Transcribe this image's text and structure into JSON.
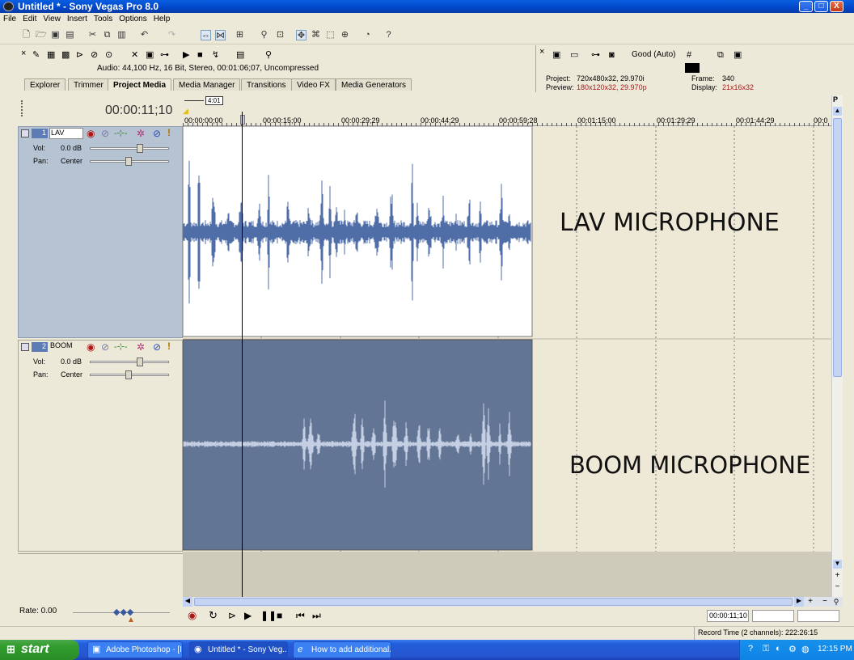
{
  "window": {
    "title": "Untitled * - Sony Vegas Pro 8.0",
    "controls": {
      "minimize": "_",
      "maximize": "□",
      "close": "X"
    }
  },
  "menu": [
    "File",
    "Edit",
    "View",
    "Insert",
    "Tools",
    "Options",
    "Help"
  ],
  "explorer": {
    "audio_info": "Audio: 44,100 Hz, 16 Bit, Stereo, 00:01:06;07, Uncompressed",
    "tabs": [
      "Explorer",
      "Trimmer",
      "Project Media",
      "Media Manager",
      "Transitions",
      "Video FX",
      "Media Generators"
    ],
    "active_tab": "Project Media"
  },
  "preview": {
    "quality": "Good (Auto)",
    "project_label": "Project:",
    "project_value": "720x480x32, 29.970i",
    "preview_label": "Preview:",
    "preview_value": "180x120x32, 29.970p",
    "frame_label": "Frame:",
    "frame_value": "340",
    "display_label": "Display:",
    "display_value": "21x16x32"
  },
  "timeline": {
    "timecode": "00:00:11;10",
    "loop_marker": "4:01",
    "ruler_labels": [
      "00:00:00;00",
      "00:00:15;00",
      "00:00:29;29",
      "00:00:44;29",
      "00:00:59;28",
      "00:01:15;00",
      "00:01:29;29",
      "00:01:44;29",
      "00:0"
    ]
  },
  "tracks": [
    {
      "number": "1",
      "name": "LAV",
      "vol_label": "Vol:",
      "vol_value": "0.0 dB",
      "pan_label": "Pan:",
      "pan_value": "Center"
    },
    {
      "number": "2",
      "name": "BOOM",
      "vol_label": "Vol:",
      "vol_value": "0.0 dB",
      "pan_label": "Pan:",
      "pan_value": "Center"
    }
  ],
  "overlays": {
    "lav": "LAV MICROPHONE",
    "boom": "BOOM MICROPHONE"
  },
  "rate": {
    "label": "Rate: 0.00"
  },
  "transport": {
    "timecode": "00:00:11;10"
  },
  "status": {
    "record_time": "Record Time (2 channels): 222:26:15"
  },
  "taskbar": {
    "start": "start",
    "tasks": [
      {
        "label": "Adobe Photoshop - [I...",
        "active": false
      },
      {
        "label": "Untitled * - Sony Veg...",
        "active": true
      },
      {
        "label": "How to add additional...",
        "active": false
      }
    ],
    "clock": "12:15 PM"
  },
  "colors": {
    "lav_wave": "#4f6ea8",
    "boom_bg": "#637594",
    "boom_wave": "#c4cfe3",
    "timeline_bg": "#ede9d6"
  }
}
